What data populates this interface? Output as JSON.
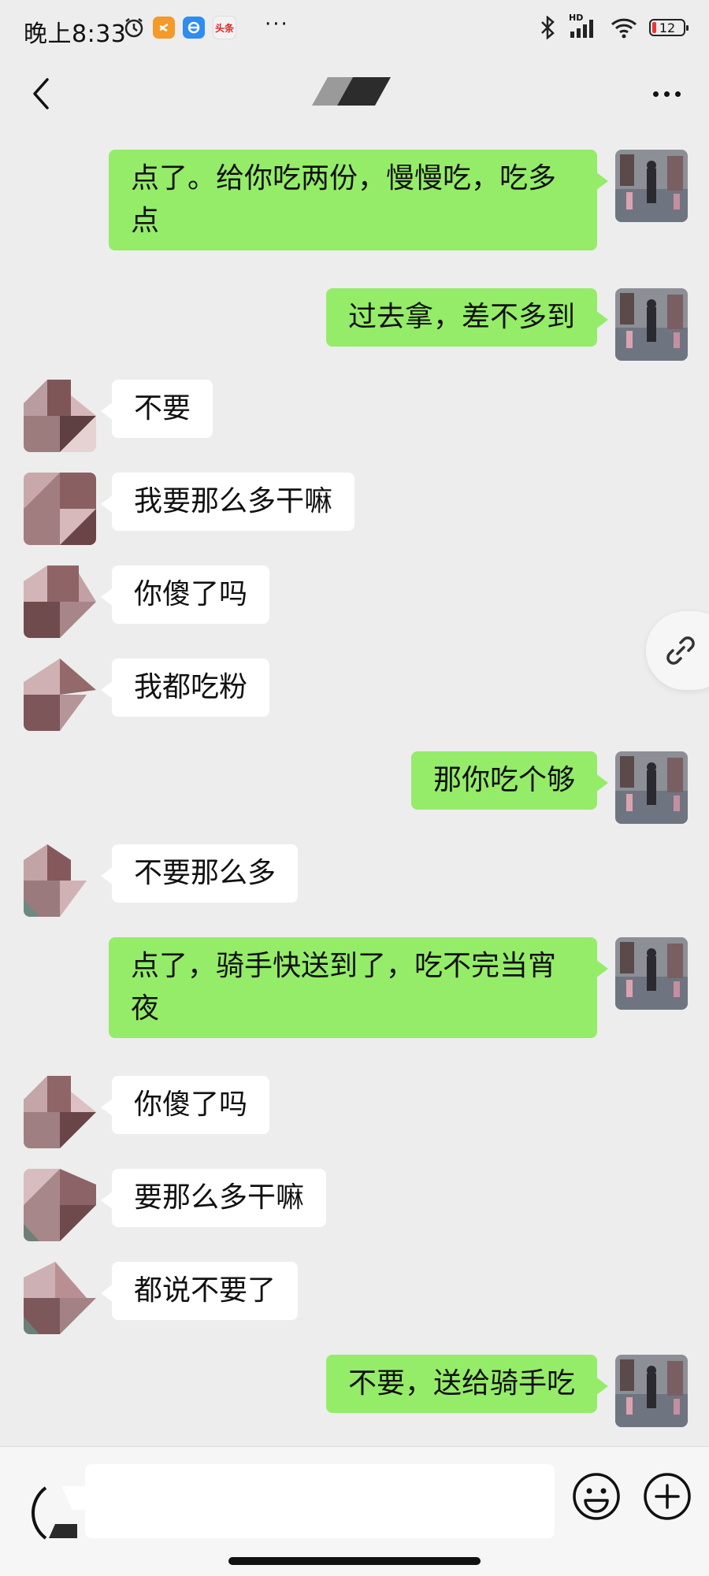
{
  "status_bar": {
    "time": "晚上8:33",
    "icons": [
      "alarm-icon",
      "app-orange-icon",
      "app-blue-icon",
      "toutiao-icon",
      "more-notifications-icon",
      "bluetooth-icon",
      "hd-signal-icon",
      "wifi-icon",
      "battery-icon"
    ],
    "battery_level": "12",
    "toutiao_label": "头条",
    "hd_label": "HD"
  },
  "nav": {
    "back": "back-icon",
    "title_obscured": true,
    "more": "more-icon"
  },
  "colors": {
    "background": "#ededed",
    "sent_bubble": "#95ec69",
    "received_bubble": "#ffffff",
    "input_bar": "#f6f6f6"
  },
  "messages": [
    {
      "side": "sent",
      "text": "点了。给你吃两份，慢慢吃，吃多点"
    },
    {
      "side": "sent",
      "text": "过去拿，差不多到"
    },
    {
      "side": "received",
      "text": "不要"
    },
    {
      "side": "received",
      "text": "我要那么多干嘛"
    },
    {
      "side": "received",
      "text": "你傻了吗"
    },
    {
      "side": "received",
      "text": "我都吃粉"
    },
    {
      "side": "sent",
      "text": "那你吃个够"
    },
    {
      "side": "received",
      "text": "不要那么多"
    },
    {
      "side": "sent",
      "text": "点了，骑手快送到了，吃不完当宵夜"
    },
    {
      "side": "received",
      "text": "你傻了吗"
    },
    {
      "side": "received",
      "text": "要那么多干嘛"
    },
    {
      "side": "received",
      "text": "都说不要了"
    },
    {
      "side": "sent",
      "text": "不要，送给骑手吃"
    }
  ],
  "floating": {
    "icon": "link-icon"
  },
  "input_bar": {
    "voice": "voice-icon",
    "text_value": "",
    "emoji": "emoji-icon",
    "plus": "plus-icon"
  }
}
